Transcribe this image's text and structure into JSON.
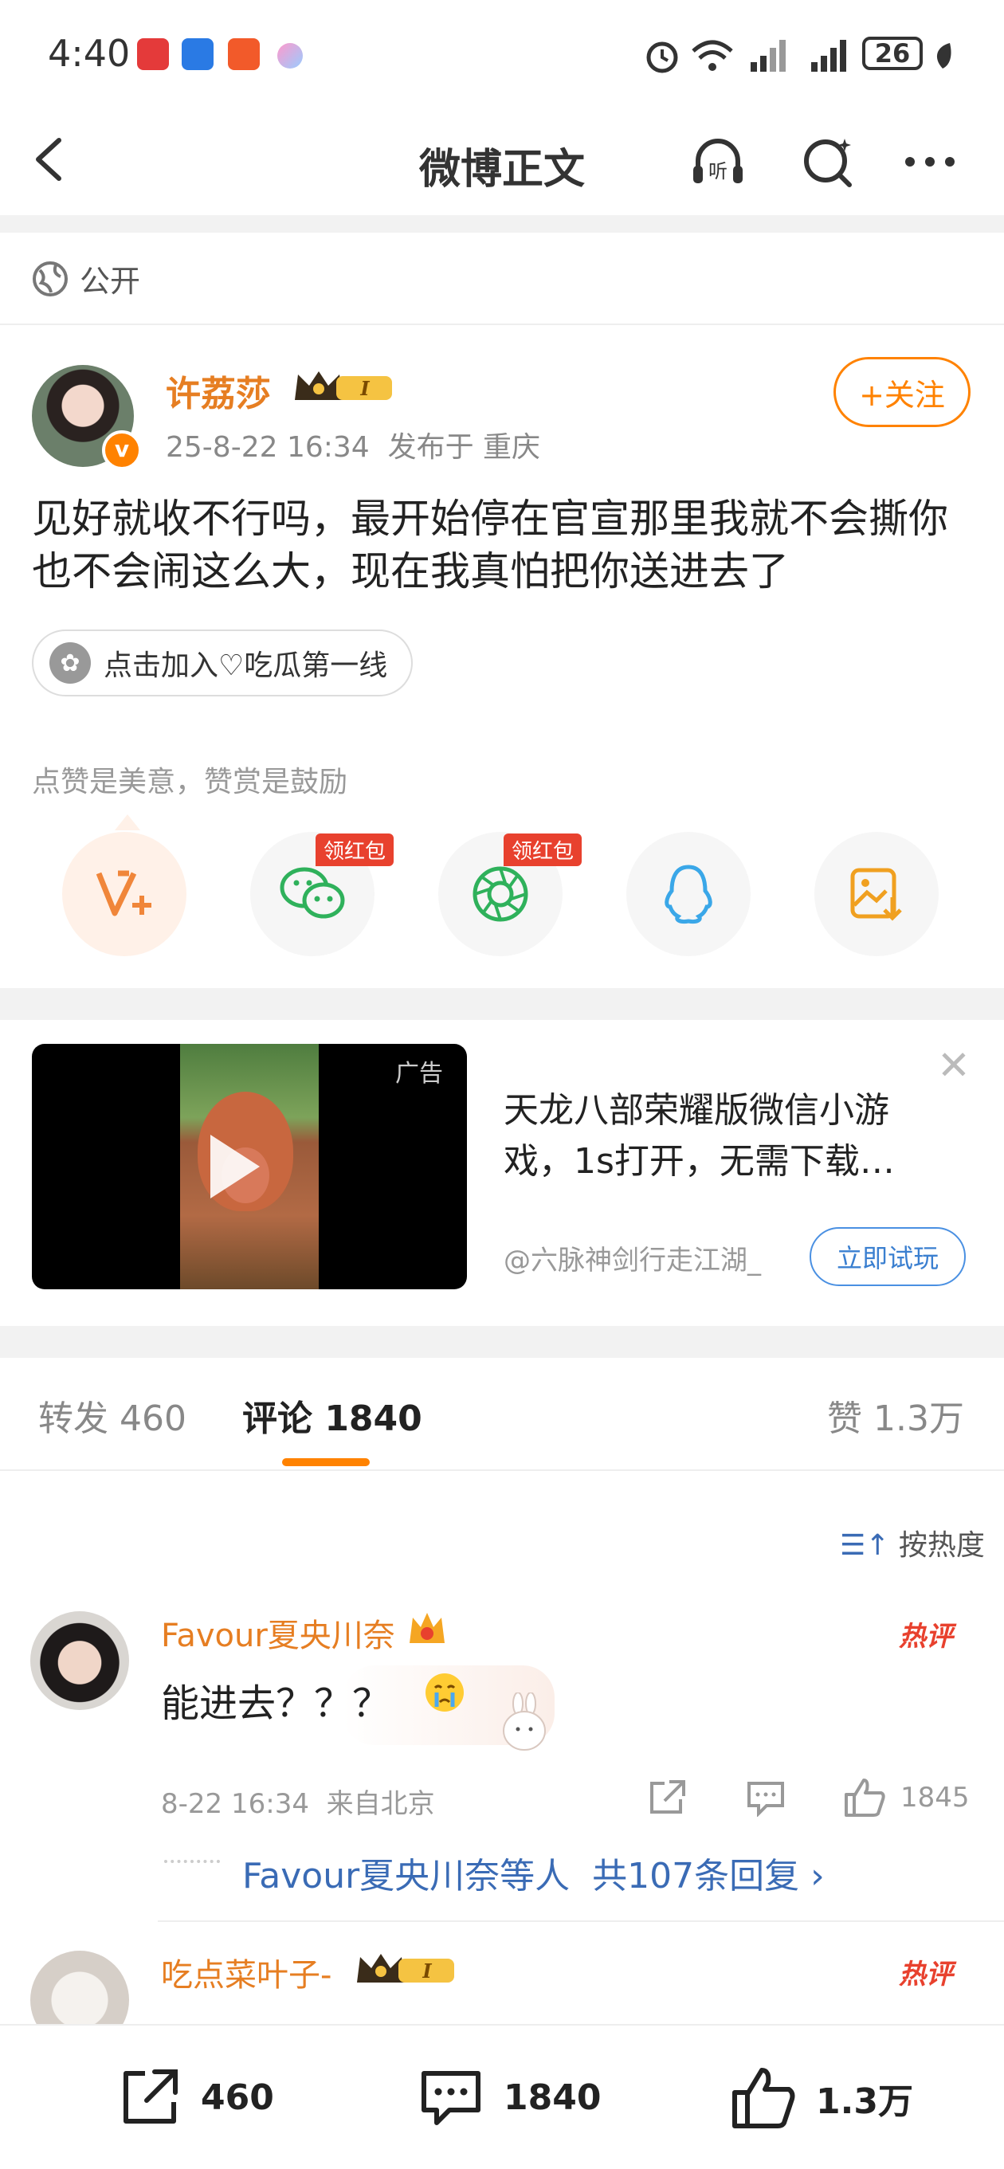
{
  "status_bar": {
    "time": "4:40",
    "battery": "26"
  },
  "header": {
    "title": "微博正文"
  },
  "visibility": {
    "label": "公开"
  },
  "post": {
    "author": "许荔莎",
    "level_badge": "I",
    "verified_badge": "v",
    "time": "25-8-22 16:34",
    "location": "发布于 重庆",
    "follow_label": "+关注",
    "content": "见好就收不行吗，最开始停在官宣那里我就不会撕你也不会闹这么大，现在我真怕把你送进去了",
    "tag": "点击加入♡吃瓜第一线",
    "reward_hint": "点赞是美意，赞赏是鼓励",
    "share_badges": [
      "领红包",
      "领红包"
    ]
  },
  "ad": {
    "label": "广告",
    "title": "天龙八部荣耀版微信小游戏，1s打开，无需下载…",
    "source": "@六脉神剑行走江湖_",
    "cta": "立即试玩"
  },
  "tabs": {
    "repost": "转发 460",
    "comments": "评论 1840",
    "likes": "赞 1.3万"
  },
  "sort": {
    "label": "按热度"
  },
  "comments": [
    {
      "name": "Favour夏央川奈",
      "hot": "热评",
      "text": "能进去？？？",
      "time": "8-22 16:34",
      "location": "来自北京",
      "likes": "1845",
      "replies_prefix": "Favour夏央川奈等人",
      "replies_count": "共107条回复 ›"
    },
    {
      "name": "吃点菜叶子-",
      "hot": "热评",
      "level_badge": "I"
    }
  ],
  "bottom_bar": {
    "reposts": "460",
    "comments": "1840",
    "likes": "1.3万"
  },
  "colors": {
    "brand_orange": "#ff8200",
    "link_blue": "#3a6bb5",
    "hot_red": "#e8412e"
  }
}
